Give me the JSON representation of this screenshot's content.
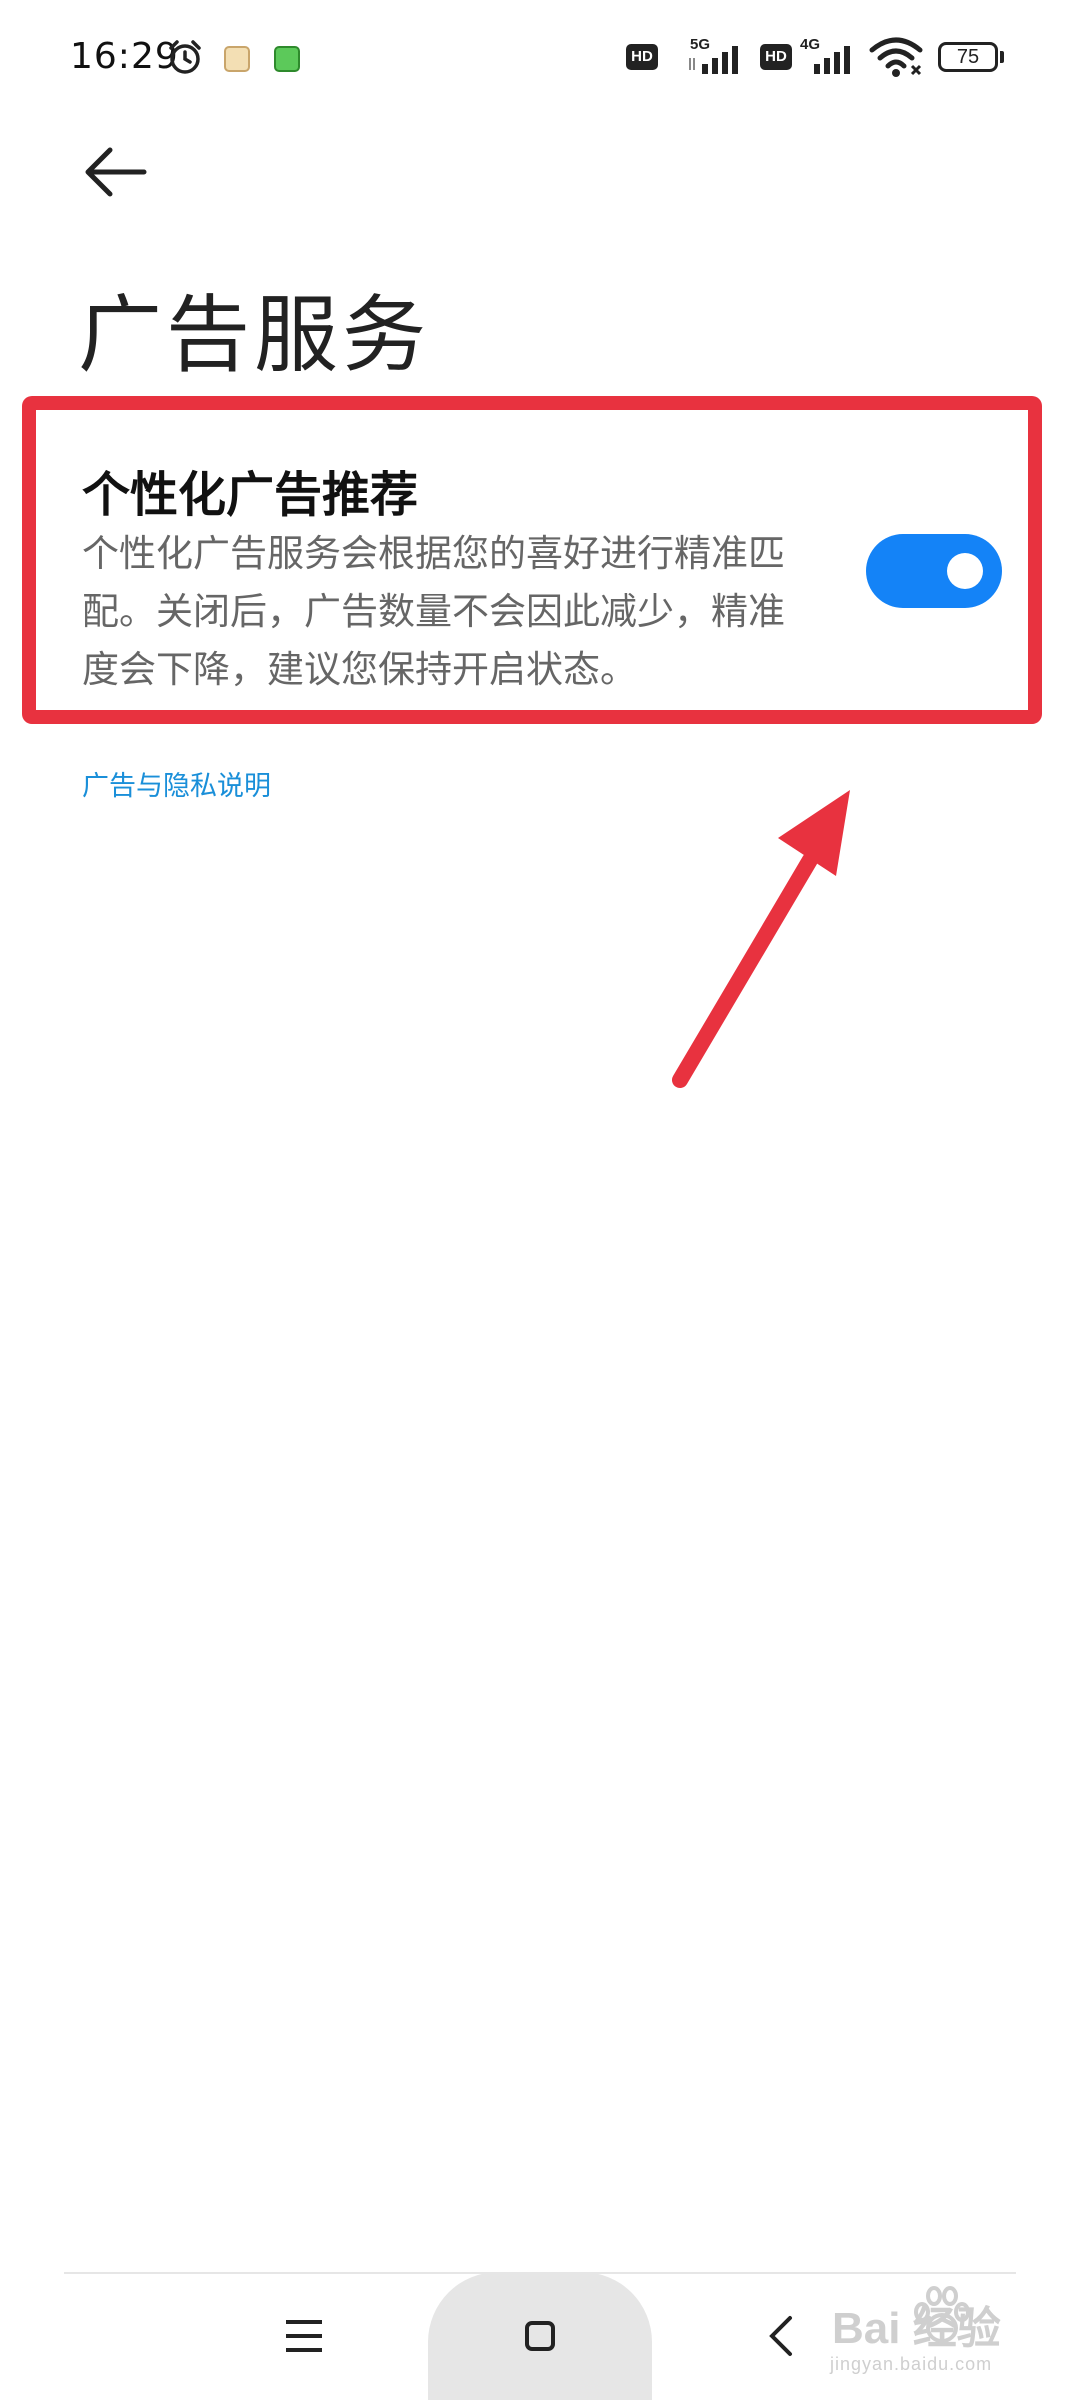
{
  "status_bar": {
    "time": "16:29",
    "hd_1": "HD",
    "net_1": "5G",
    "hd_2": "HD",
    "net_2": "4G",
    "battery": "75",
    "icons": [
      "alarm-icon",
      "app-icon-1",
      "app-icon-2",
      "signal-icon",
      "wifi-icon",
      "battery-icon"
    ]
  },
  "header": {
    "back_icon": "arrow-left-icon",
    "title": "广告服务"
  },
  "setting": {
    "title": "个性化广告推荐",
    "description_lines": [
      "个性化广告服务会根据您的喜好进行精准匹",
      "配。关闭后，广告数量不会因此减少，精准",
      "度会下降，建议您保持开启状态。"
    ],
    "toggle_on": true
  },
  "link": {
    "label": "广告与隐私说明"
  },
  "nav_bar": {
    "icons": [
      "menu-icon",
      "home-icon",
      "back-icon"
    ]
  },
  "watermark": {
    "brand": "Bai  经验",
    "url": "jingyan.baidu.com"
  },
  "colors": {
    "accent": "#1483f7",
    "link": "#1a8fd9",
    "annotation": "#e8323f"
  }
}
